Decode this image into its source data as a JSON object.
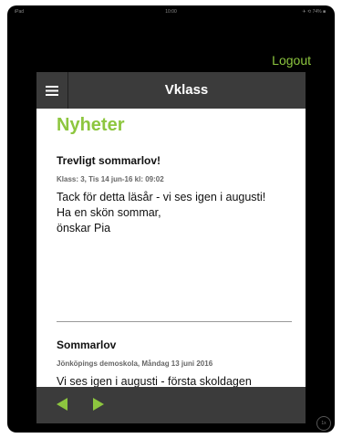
{
  "statusbar": {
    "left": "iPad",
    "time": "10:00",
    "right": "✈ ⟲ 74% ■"
  },
  "header": {
    "logout_label": "Logout",
    "app_title": "Vklass"
  },
  "news": {
    "heading": "Nyheter",
    "posts": [
      {
        "title": "Trevligt sommarlov!",
        "meta": "Klass: 3, Tis 14 jun-16 kl: 09:02",
        "body": [
          "Tack för detta läsår - vi ses igen i augusti!",
          "Ha en skön sommar,",
          "önskar Pia"
        ]
      },
      {
        "title": "Sommarlov",
        "meta": "Jönköpings demoskola, Måndag 13 juni 2016",
        "body": [
          "Vi ses igen i augusti - första skoldagen"
        ]
      }
    ]
  },
  "icons": {
    "menu": "hamburger-icon",
    "back": "back-arrow-icon",
    "forward": "forward-arrow-icon"
  },
  "colors": {
    "accent": "#8dc63f",
    "bar": "#3b3b3b",
    "frame": "#000000"
  }
}
